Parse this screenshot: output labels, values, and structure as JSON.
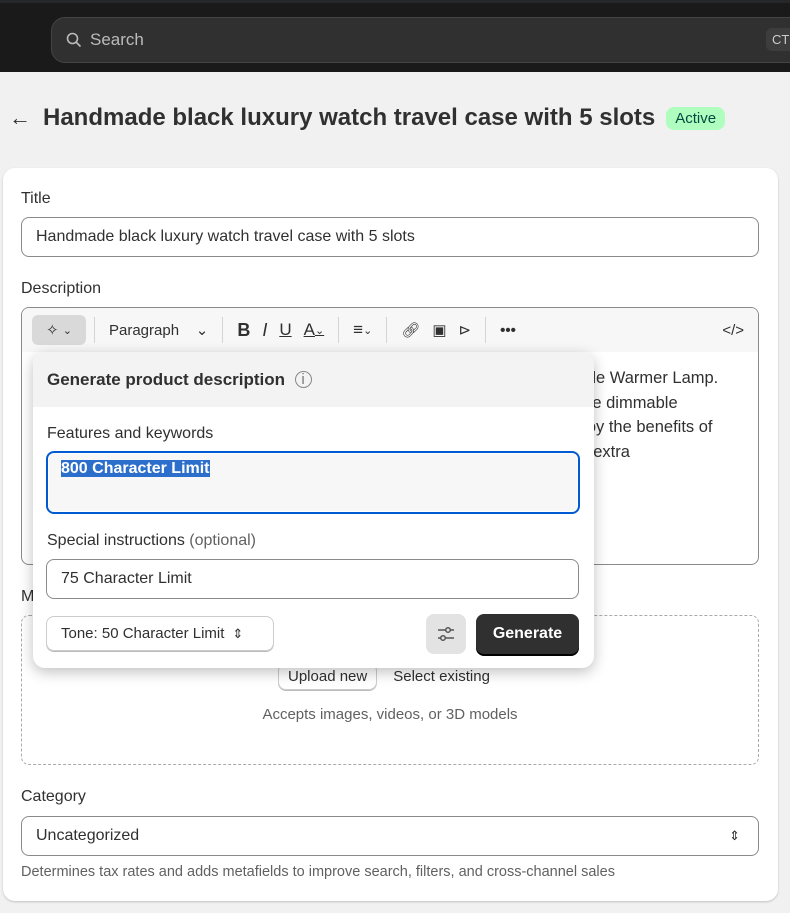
{
  "topbar": {
    "search_placeholder": "Search",
    "shortcut": "CTRL"
  },
  "header": {
    "title": "Handmade black luxury watch travel case with 5 slots",
    "status": "Active"
  },
  "form": {
    "title_label": "Title",
    "title_value": "Handmade black luxury watch travel case with 5 slots",
    "description_label": "Description",
    "toolbar": {
      "paragraph": "Paragraph"
    },
    "description_text": "ndle Warmer Lamp.\n the dimmable\nnjoy the benefits of\nor extra",
    "media_label": "Media",
    "upload_new": "Upload new",
    "select_existing": "Select existing",
    "accepts": "Accepts images, videos, or 3D models",
    "category_label": "Category",
    "category_value": "Uncategorized",
    "category_hint": "Determines tax rates and adds metafields to improve search, filters, and cross-channel sales"
  },
  "popover": {
    "title": "Generate product description",
    "features_label": "Features and keywords",
    "features_value": "800 Character Limit",
    "special_label": "Special instructions",
    "special_optional": "(optional)",
    "special_value": "75 Character Limit",
    "tone": "Tone: 50 Character Limit",
    "generate": "Generate"
  }
}
